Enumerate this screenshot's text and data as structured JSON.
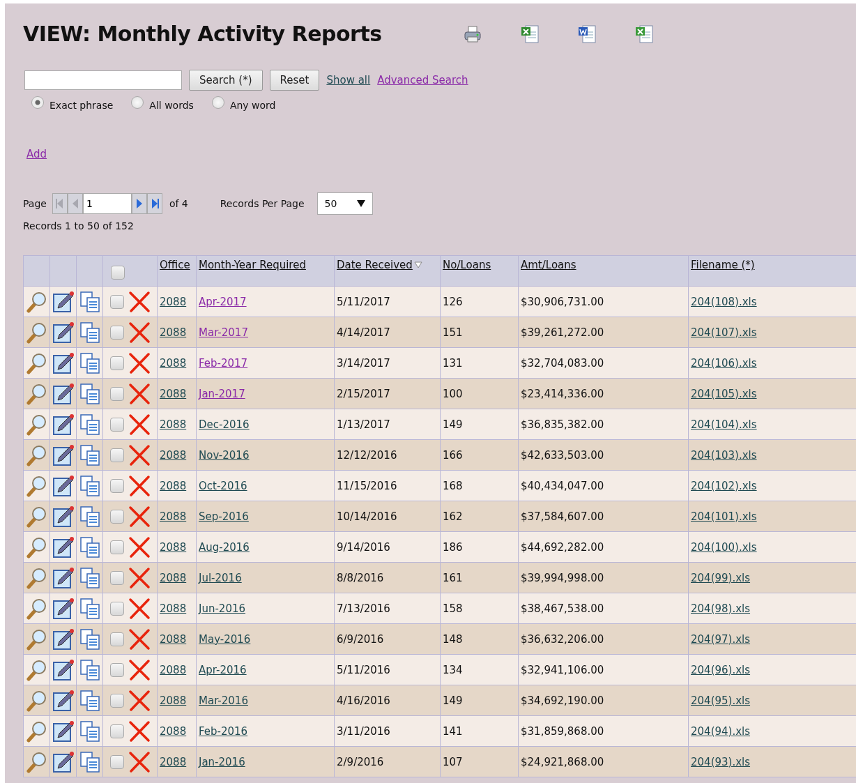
{
  "title": "VIEW: Monthly Activity Reports",
  "search": {
    "buttons": [
      "Search (*)",
      "Reset"
    ],
    "links": [
      {
        "label": "Show all",
        "visited": false
      },
      {
        "label": "Advanced Search",
        "visited": true
      }
    ]
  },
  "search_modes": [
    {
      "label": "Exact phrase",
      "selected": true
    },
    {
      "label": "All words",
      "selected": false
    },
    {
      "label": "Any word",
      "selected": false
    }
  ],
  "add_link": {
    "label": "Add",
    "visited": true
  },
  "pager": {
    "label": "Page",
    "page": "1",
    "of": "of 4",
    "per_page_label": "Records Per Page",
    "per_page": "50",
    "summary": "Records 1 to 50 of 152"
  },
  "table": {
    "select_all_checked": false,
    "columns": [
      {
        "label": "Office",
        "sorted": false
      },
      {
        "label": "Month-Year Required",
        "sorted": false
      },
      {
        "label": "Date Received",
        "sorted": true
      },
      {
        "label": "No/Loans",
        "sorted": false
      },
      {
        "label": "Amt/Loans",
        "sorted": false
      },
      {
        "label": "Filename (*)",
        "sorted": false
      }
    ],
    "rows": [
      {
        "checked": false,
        "office": "2088",
        "month": "Apr-2017",
        "visited": true,
        "date": "5/11/2017",
        "loans": "126",
        "amount": "$30,906,731.00",
        "filename": "204(108).xls"
      },
      {
        "checked": false,
        "office": "2088",
        "month": "Mar-2017",
        "visited": true,
        "date": "4/14/2017",
        "loans": "151",
        "amount": "$39,261,272.00",
        "filename": "204(107).xls"
      },
      {
        "checked": false,
        "office": "2088",
        "month": "Feb-2017",
        "visited": true,
        "date": "3/14/2017",
        "loans": "131",
        "amount": "$32,704,083.00",
        "filename": "204(106).xls"
      },
      {
        "checked": false,
        "office": "2088",
        "month": "Jan-2017",
        "visited": true,
        "date": "2/15/2017",
        "loans": "100",
        "amount": "$23,414,336.00",
        "filename": "204(105).xls"
      },
      {
        "checked": false,
        "office": "2088",
        "month": "Dec-2016",
        "visited": false,
        "date": "1/13/2017",
        "loans": "149",
        "amount": "$36,835,382.00",
        "filename": "204(104).xls"
      },
      {
        "checked": false,
        "office": "2088",
        "month": "Nov-2016",
        "visited": false,
        "date": "12/12/2016",
        "loans": "166",
        "amount": "$42,633,503.00",
        "filename": "204(103).xls"
      },
      {
        "checked": false,
        "office": "2088",
        "month": "Oct-2016",
        "visited": false,
        "date": "11/15/2016",
        "loans": "168",
        "amount": "$40,434,047.00",
        "filename": "204(102).xls"
      },
      {
        "checked": false,
        "office": "2088",
        "month": "Sep-2016",
        "visited": false,
        "date": "10/14/2016",
        "loans": "162",
        "amount": "$37,584,607.00",
        "filename": "204(101).xls"
      },
      {
        "checked": false,
        "office": "2088",
        "month": "Aug-2016",
        "visited": false,
        "date": "9/14/2016",
        "loans": "186",
        "amount": "$44,692,282.00",
        "filename": "204(100).xls"
      },
      {
        "checked": false,
        "office": "2088",
        "month": "Jul-2016",
        "visited": false,
        "date": "8/8/2016",
        "loans": "161",
        "amount": "$39,994,998.00",
        "filename": "204(99).xls"
      },
      {
        "checked": false,
        "office": "2088",
        "month": "Jun-2016",
        "visited": false,
        "date": "7/13/2016",
        "loans": "158",
        "amount": "$38,467,538.00",
        "filename": "204(98).xls"
      },
      {
        "checked": false,
        "office": "2088",
        "month": "May-2016",
        "visited": false,
        "date": "6/9/2016",
        "loans": "148",
        "amount": "$36,632,206.00",
        "filename": "204(97).xls"
      },
      {
        "checked": false,
        "office": "2088",
        "month": "Apr-2016",
        "visited": false,
        "date": "5/11/2016",
        "loans": "134",
        "amount": "$32,941,106.00",
        "filename": "204(96).xls"
      },
      {
        "checked": false,
        "office": "2088",
        "month": "Mar-2016",
        "visited": false,
        "date": "4/16/2016",
        "loans": "149",
        "amount": "$34,692,190.00",
        "filename": "204(95).xls"
      },
      {
        "checked": false,
        "office": "2088",
        "month": "Feb-2016",
        "visited": false,
        "date": "3/11/2016",
        "loans": "141",
        "amount": "$31,859,868.00",
        "filename": "204(94).xls"
      },
      {
        "checked": false,
        "office": "2088",
        "month": "Jan-2016",
        "visited": false,
        "date": "2/9/2016",
        "loans": "107",
        "amount": "$24,921,868.00",
        "filename": "204(93).xls"
      }
    ]
  }
}
